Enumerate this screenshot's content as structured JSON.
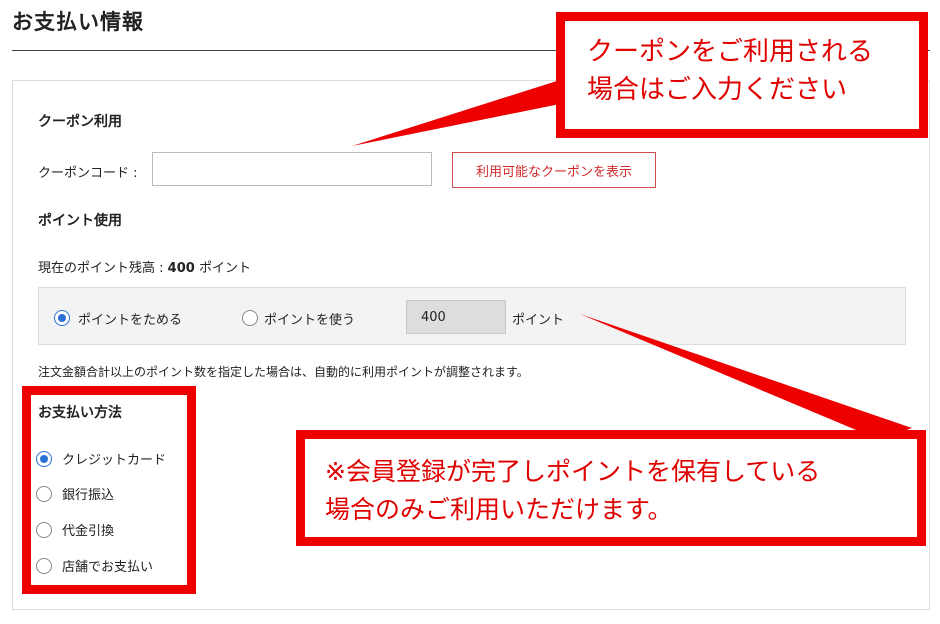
{
  "page": {
    "title": "お支払い情報"
  },
  "coupon": {
    "heading": "クーポン利用",
    "code_label": "クーポンコード :",
    "code_value": "",
    "show_button": "利用可能なクーポンを表示"
  },
  "points": {
    "heading": "ポイント使用",
    "balance_label": "現在のポイント残高 :",
    "balance_value": "400",
    "balance_unit": "ポイント",
    "option_save": "ポイントをためる",
    "option_use": "ポイントを使う",
    "use_amount": "400",
    "use_unit": "ポイント",
    "selected": "save",
    "note": "注文金額合計以上のポイント数を指定した場合は、自動的に利用ポイントが調整されます。"
  },
  "payment": {
    "heading": "お支払い方法",
    "methods": [
      "クレジットカード",
      "銀行振込",
      "代金引換",
      "店舗でお支払い"
    ],
    "selected": "クレジットカード"
  },
  "callouts": {
    "coupon_line1": "クーポンをご利用される",
    "coupon_line2": "場合はご入力ください",
    "points_line1": "※会員登録が完了しポイントを保有している",
    "points_line2": "場合のみご利用いただけます。"
  },
  "colors": {
    "accent": "#2b6fd6",
    "callout_red": "#ee0000",
    "button_red": "#d22a2a"
  }
}
